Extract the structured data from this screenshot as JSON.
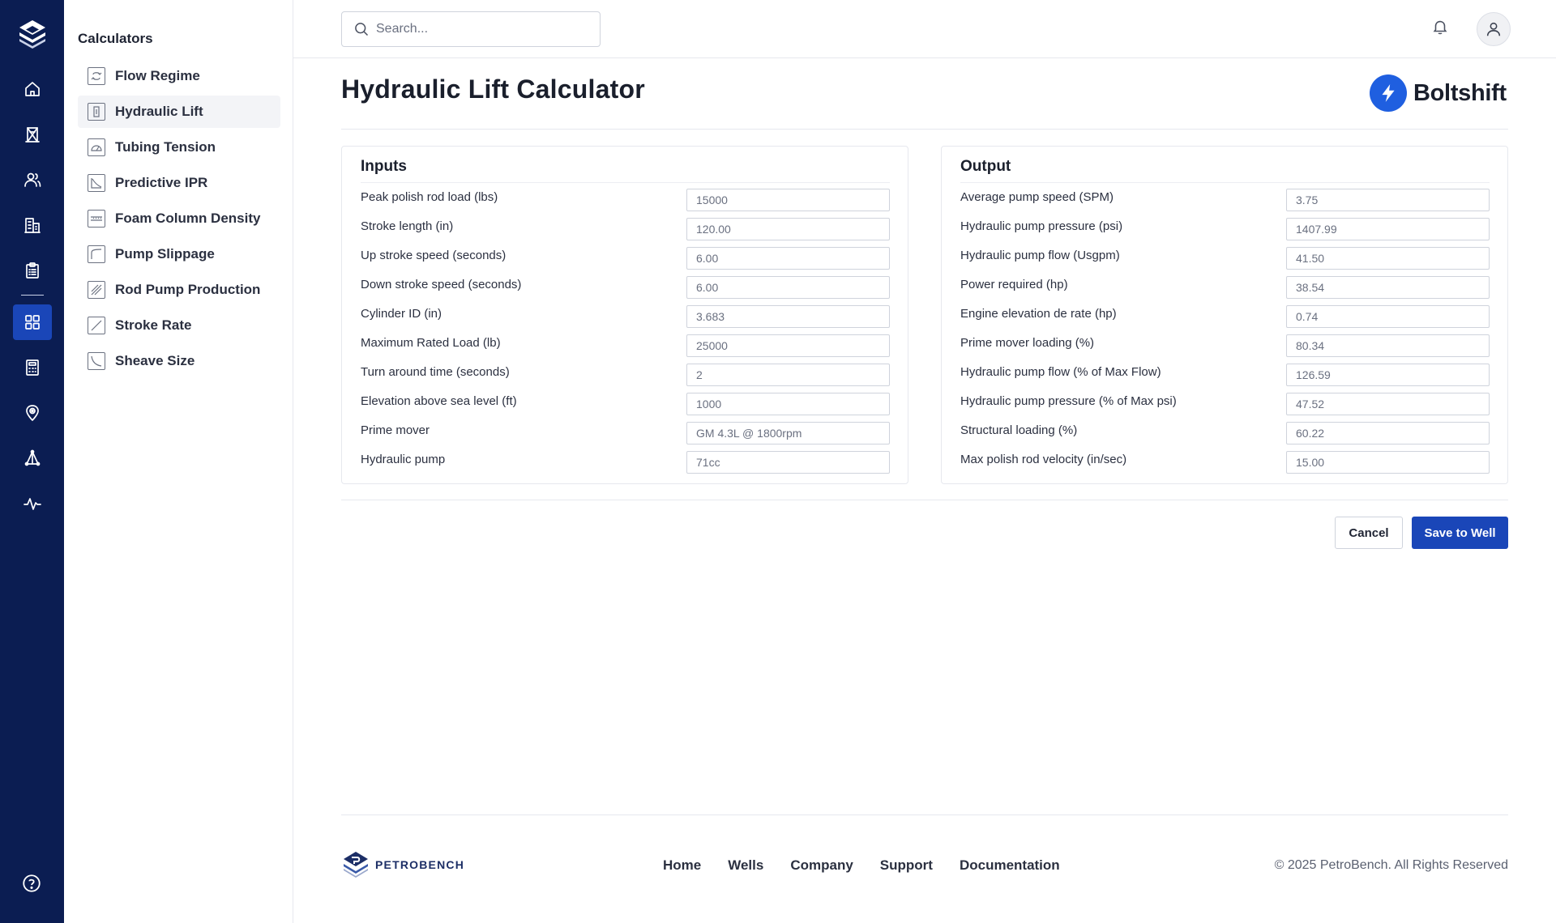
{
  "app": {
    "brand_partner": "Boltshift",
    "footer_brand": "PETROBENCH"
  },
  "colors": {
    "rail": "#0b1d52",
    "accent": "#1a46b8",
    "bolt": "#1f5fe0"
  },
  "rail": {
    "icons": [
      "app-logo-icon",
      "home-icon",
      "oil-rig-icon",
      "users-icon",
      "building-icon",
      "clipboard-icon",
      "grid-icon",
      "calculator-icon",
      "location-icon",
      "network-icon",
      "activity-icon",
      "help-icon"
    ]
  },
  "sidebar": {
    "heading": "Calculators",
    "items": [
      {
        "label": "Flow Regime"
      },
      {
        "label": "Hydraulic Lift"
      },
      {
        "label": "Tubing Tension"
      },
      {
        "label": "Predictive IPR"
      },
      {
        "label": "Foam Column Density"
      },
      {
        "label": "Pump Slippage"
      },
      {
        "label": "Rod Pump Production"
      },
      {
        "label": "Stroke Rate"
      },
      {
        "label": "Sheave Size"
      }
    ]
  },
  "search": {
    "placeholder": "Search..."
  },
  "page": {
    "title": "Hydraulic Lift Calculator"
  },
  "inputs": {
    "heading": "Inputs",
    "rows": [
      {
        "label": "Peak polish rod load (lbs)",
        "value": "15000"
      },
      {
        "label": "Stroke length (in)",
        "value": "120.00"
      },
      {
        "label": "Up stroke speed (seconds)",
        "value": "6.00"
      },
      {
        "label": "Down stroke speed (seconds)",
        "value": "6.00"
      },
      {
        "label": "Cylinder ID (in)",
        "value": "3.683"
      },
      {
        "label": "Maximum Rated Load (lb)",
        "value": "25000"
      },
      {
        "label": "Turn around time (seconds)",
        "value": "2"
      },
      {
        "label": "Elevation above sea level (ft)",
        "value": "1000"
      },
      {
        "label": "Prime mover",
        "value": "GM 4.3L @ 1800rpm"
      },
      {
        "label": "Hydraulic pump",
        "value": "71cc"
      }
    ]
  },
  "output": {
    "heading": "Output",
    "rows": [
      {
        "label": "Average pump speed (SPM)",
        "value": "3.75"
      },
      {
        "label": "Hydraulic pump pressure (psi)",
        "value": "1407.99"
      },
      {
        "label": "Hydraulic pump flow (Usgpm)",
        "value": "41.50"
      },
      {
        "label": "Power required (hp)",
        "value": "38.54"
      },
      {
        "label": "Engine elevation de rate (hp)",
        "value": "0.74"
      },
      {
        "label": "Prime mover loading (%)",
        "value": "80.34"
      },
      {
        "label": "Hydraulic pump flow (% of Max Flow)",
        "value": "126.59"
      },
      {
        "label": "Hydraulic pump pressure (% of Max psi)",
        "value": "47.52"
      },
      {
        "label": "Structural loading (%)",
        "value": "60.22"
      },
      {
        "label": "Max polish rod velocity (in/sec)",
        "value": "15.00"
      }
    ]
  },
  "actions": {
    "cancel_label": "Cancel",
    "save_label": "Save to Well"
  },
  "footer": {
    "links": [
      "Home",
      "Wells",
      "Company",
      "Support",
      "Documentation"
    ],
    "copyright": "© 2025 PetroBench. All Rights Reserved"
  }
}
